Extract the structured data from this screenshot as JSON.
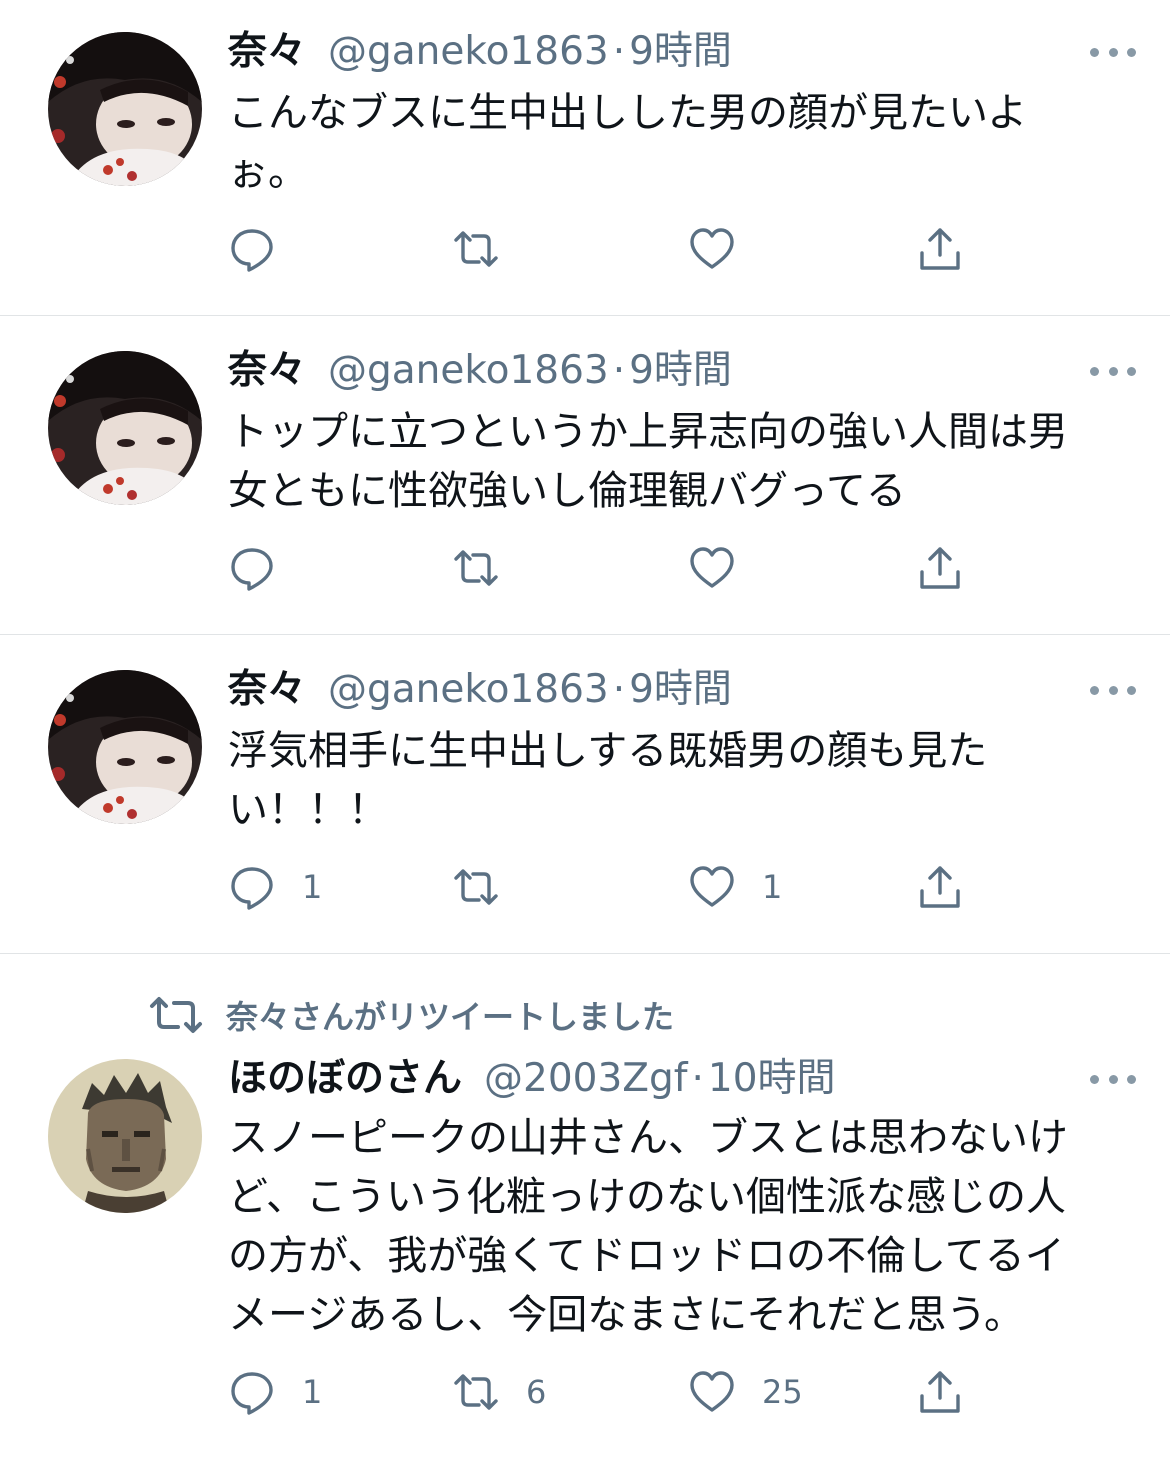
{
  "colors": {
    "text": "#0f1419",
    "muted": "#5b7083",
    "divider": "#e1e4e6",
    "icon": "#5b7083"
  },
  "tweets": [
    {
      "name": "奈々",
      "handle": "@ganeko1863",
      "separator": "·",
      "time": "9時間",
      "text": "こんなブスに生中出しした男の顔が見たいよ\nぉ。",
      "reply_count": "",
      "retweet_count": "",
      "like_count": "",
      "avatar": "woman-with-fan"
    },
    {
      "name": "奈々",
      "handle": "@ganeko1863",
      "separator": "·",
      "time": "9時間",
      "text": "トップに立つというか上昇志向の強い人間は男\n女ともに性欲強いし倫理観バグってる",
      "reply_count": "",
      "retweet_count": "",
      "like_count": "",
      "avatar": "woman-with-fan"
    },
    {
      "name": "奈々",
      "handle": "@ganeko1863",
      "separator": "·",
      "time": "9時間",
      "text": "浮気相手に生中出しする既婚男の顔も見た\nい！！！",
      "reply_count": "1",
      "retweet_count": "",
      "like_count": "1",
      "avatar": "woman-with-fan"
    },
    {
      "retweet_banner": "奈々さんがリツイートしました",
      "name": "ほのぼのさん",
      "handle": "@2003Zgf",
      "separator": "·",
      "time": "10時間",
      "text": "スノーピークの山井さん、ブスとは思わないけ\nど、こういう化粧っけのない個性派な感じの人\nの方が、我が強くてドロッドロの不倫してるイ\nメージあるし、今回なまさにそれだと思う。",
      "reply_count": "1",
      "retweet_count": "6",
      "like_count": "25",
      "avatar": "pixel-art-man"
    }
  ]
}
